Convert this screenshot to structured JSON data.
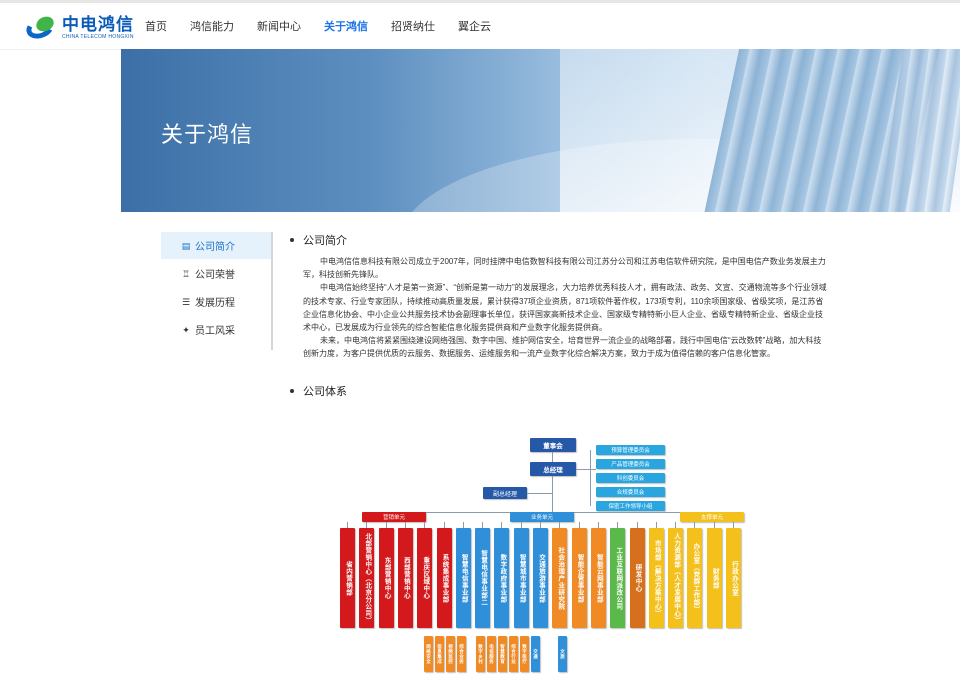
{
  "header": {
    "logo_cn": "中电鸿信",
    "logo_en": "CHINA TELECOM HONGXIN",
    "nav": [
      {
        "label": "首页",
        "active": false
      },
      {
        "label": "鸿信能力",
        "active": false
      },
      {
        "label": "新闻中心",
        "active": false
      },
      {
        "label": "关于鸿信",
        "active": true
      },
      {
        "label": "招贤纳仕",
        "active": false
      },
      {
        "label": "翼企云",
        "active": false
      }
    ]
  },
  "banner": {
    "title": "关于鸿信"
  },
  "sidebar": {
    "items": [
      {
        "label": "公司简介",
        "icon": "document-icon",
        "active": true
      },
      {
        "label": "公司荣誉",
        "icon": "trophy-icon",
        "active": false
      },
      {
        "label": "发展历程",
        "icon": "timeline-icon",
        "active": false
      },
      {
        "label": "员工风采",
        "icon": "star-icon",
        "active": false
      }
    ]
  },
  "intro": {
    "title": "公司简介",
    "paragraphs": [
      "中电鸿信信息科技有限公司成立于2007年，同时挂牌中电信数智科技有限公司江苏分公司和江苏电信软件研究院，是中国电信产数业务发展主力军，科技创新先锋队。",
      "中电鸿信始终坚持“人才是第一资源”、“创新是第一动力”的发展理念，大力培养优秀科技人才，拥有政法、政务、文宣、交通物流等多个行业领域的技术专家、行业专家团队，持续推动高质量发展，累计获得37项企业资质，871项软件著作权，173项专利，110余项国家级、省级奖项，是江苏省企业信息化协会、中小企业公共服务技术协会副理事长单位，获评国家高新技术企业、国家级专精特新小巨人企业、省级专精特新企业、省级企业技术中心，已发展成为行业领先的综合智能信息化服务提供商和产业数字化服务提供商。",
      "未来，中电鸿信将紧紧围绕建设网络强国、数字中国、维护网信安全，培育世界一流企业的战略部署，践行中国电信“云改数转”战略，加大科技创新力度，为客户提供优质的云服务、数据服务、运维服务和一流产业数字化综合解决方案，致力于成为值得信赖的客户信息化管家。"
    ]
  },
  "org": {
    "title": "公司体系",
    "board": "董事会",
    "gm": "总经理",
    "vgm": "副总经理",
    "committees": [
      "预算管理委员会",
      "产品管理委员会",
      "科创委员会",
      "合规委员会",
      "保密工作领导小组"
    ],
    "unit_sales": "营销单元",
    "unit_business": "业务单元",
    "unit_support": "支撑单元",
    "sales_depts": [
      "省内营销部",
      "北部营销中心（北京分公司）",
      "东部营销中心",
      "西部营销中心",
      "重庆区域中心",
      "系统集成事业部"
    ],
    "business_depts": [
      "智慧电信事业部",
      "智慧电信事业部二",
      "数字政府事业部",
      "智慧城市事业部",
      "交通旅游事业部",
      "社会治理产业研究院",
      "智能企管事业部",
      "智能云网事业部",
      "工业互联网派改公司",
      "研发中心"
    ],
    "support_depts": [
      "市场部（解决方案中心）",
      "人力资源部（人才发展中心）",
      "办公室（党群工作部）",
      "财务部",
      "行政办公室"
    ],
    "sub_boxes": [
      "网络安全",
      "信息集成",
      "视频监控",
      "综合业务",
      "数字乡村",
      "电信服务",
      "智慧教育",
      "综合行业",
      "数字医疗",
      "交通",
      "文旅"
    ],
    "colors": {
      "red": "#d3191c",
      "blue": "#2f8fd9",
      "orange": "#f08a24",
      "yellow": "#f4c01c",
      "green": "#5bb84a",
      "navy": "#2559a8",
      "cyan": "#29a6e0"
    }
  }
}
